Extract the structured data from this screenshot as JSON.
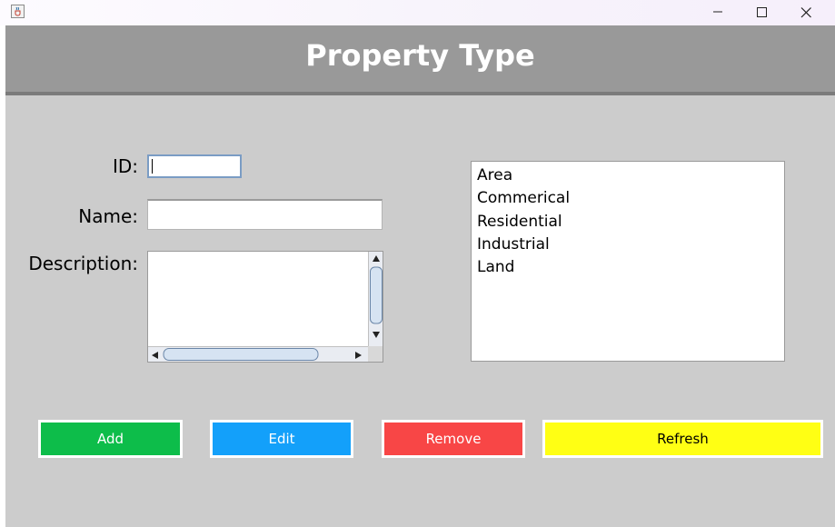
{
  "window": {
    "controls": [
      "minimize",
      "maximize",
      "close"
    ]
  },
  "header": {
    "title": "Property Type",
    "background": "#999999"
  },
  "form": {
    "id_label": "ID:",
    "id_value": "",
    "name_label": "Name:",
    "name_value": "",
    "description_label": "Description:",
    "description_value": ""
  },
  "property_types": [
    "Area",
    "Commerical",
    "Residential",
    "Industrial",
    "Land"
  ],
  "buttons": {
    "add": {
      "label": "Add",
      "color": "#0dbd4a",
      "text_color": "#ffffff"
    },
    "edit": {
      "label": "Edit",
      "color": "#13a0fa",
      "text_color": "#ffffff"
    },
    "remove": {
      "label": "Remove",
      "color": "#f84646",
      "text_color": "#ffffff"
    },
    "refresh": {
      "label": "Refresh",
      "color": "#ffff14",
      "text_color": "#000000"
    }
  },
  "icons": {
    "app": "java-coffee-cup-icon",
    "minimize": "minimize-icon",
    "maximize": "maximize-icon",
    "close": "close-icon"
  }
}
